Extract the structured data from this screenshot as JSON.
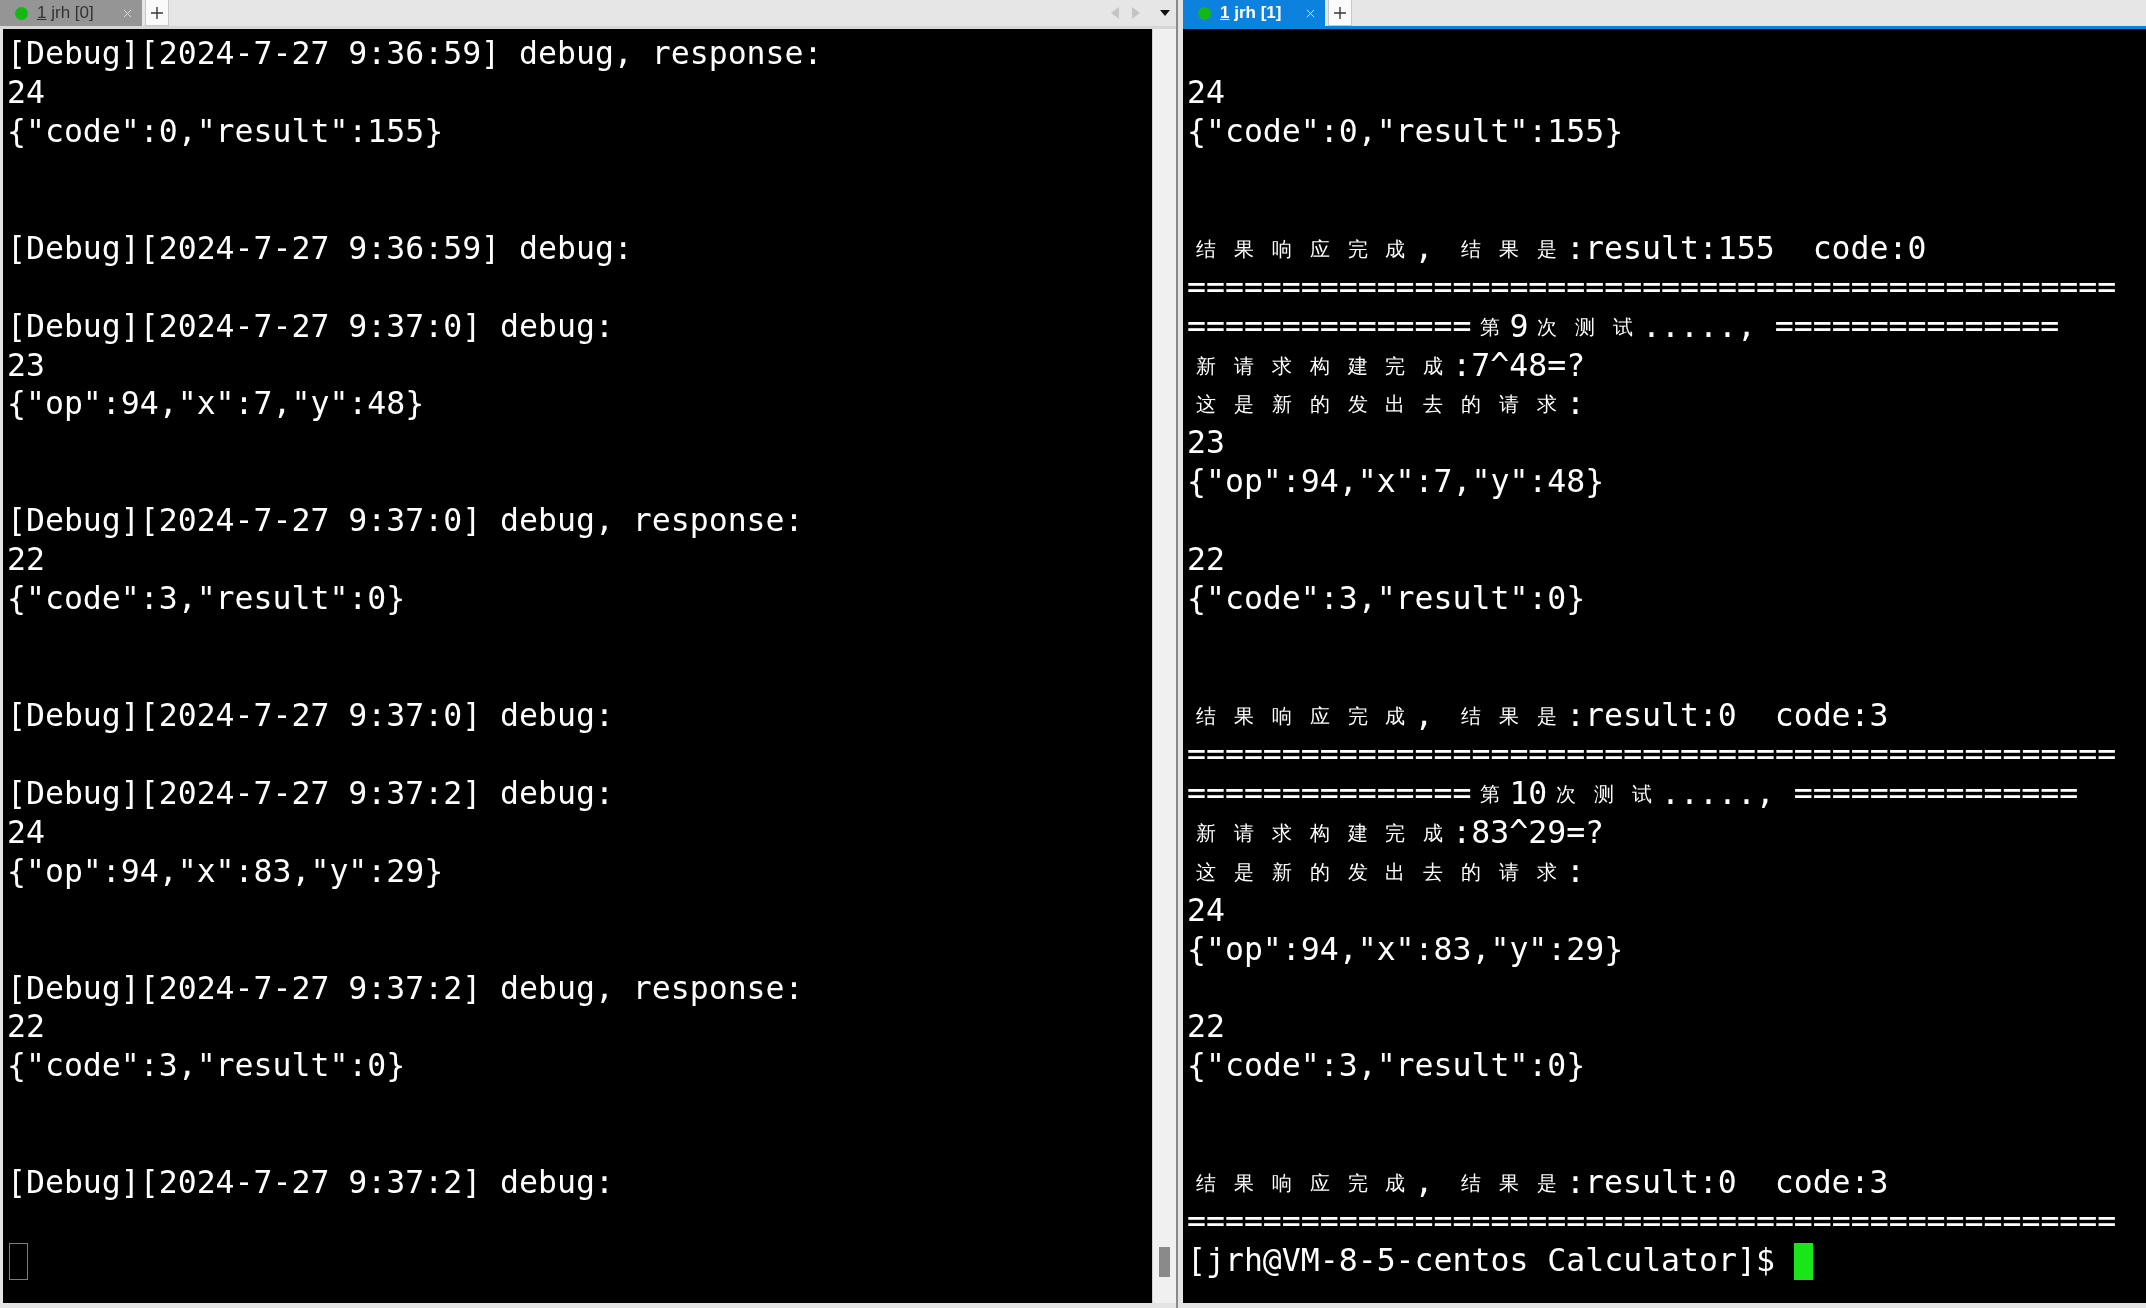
{
  "panes": [
    {
      "tab": {
        "label": "1 jrh [0]",
        "selected": false
      },
      "focused": false,
      "tab_nav": true,
      "scrollbar": true,
      "lines": [
        {
          "kind": "text",
          "text": "[Debug][2024-7-27 9:36:59] debug, response:"
        },
        {
          "kind": "text",
          "text": "24"
        },
        {
          "kind": "text",
          "text": "{\"code\":0,\"result\":155}"
        },
        {
          "kind": "blank"
        },
        {
          "kind": "blank"
        },
        {
          "kind": "text",
          "text": "[Debug][2024-7-27 9:36:59] debug:"
        },
        {
          "kind": "blank"
        },
        {
          "kind": "text",
          "text": "[Debug][2024-7-27 9:37:0] debug:"
        },
        {
          "kind": "text",
          "text": "23"
        },
        {
          "kind": "text",
          "text": "{\"op\":94,\"x\":7,\"y\":48}"
        },
        {
          "kind": "blank"
        },
        {
          "kind": "blank"
        },
        {
          "kind": "text",
          "text": "[Debug][2024-7-27 9:37:0] debug, response:"
        },
        {
          "kind": "text",
          "text": "22"
        },
        {
          "kind": "text",
          "text": "{\"code\":3,\"result\":0}"
        },
        {
          "kind": "blank"
        },
        {
          "kind": "blank"
        },
        {
          "kind": "text",
          "text": "[Debug][2024-7-27 9:37:0] debug:"
        },
        {
          "kind": "blank"
        },
        {
          "kind": "text",
          "text": "[Debug][2024-7-27 9:37:2] debug:"
        },
        {
          "kind": "text",
          "text": "24"
        },
        {
          "kind": "text",
          "text": "{\"op\":94,\"x\":83,\"y\":29}"
        },
        {
          "kind": "blank"
        },
        {
          "kind": "blank"
        },
        {
          "kind": "text",
          "text": "[Debug][2024-7-27 9:37:2] debug, response:"
        },
        {
          "kind": "text",
          "text": "22"
        },
        {
          "kind": "text",
          "text": "{\"code\":3,\"result\":0}"
        },
        {
          "kind": "blank"
        },
        {
          "kind": "blank"
        },
        {
          "kind": "text",
          "text": "[Debug][2024-7-27 9:37:2] debug:"
        },
        {
          "kind": "blank"
        }
      ]
    },
    {
      "tab": {
        "label": "1 jrh [1]",
        "selected": true
      },
      "focused": true,
      "tab_nav": false,
      "scrollbar": false,
      "lines": [
        {
          "kind": "blank"
        },
        {
          "kind": "text",
          "text": "24"
        },
        {
          "kind": "text",
          "text": "{\"code\":0,\"result\":155}"
        },
        {
          "kind": "blank"
        },
        {
          "kind": "blank"
        },
        {
          "kind": "text",
          "text": "结果响应完成, 结果是:result:155  code:0"
        },
        {
          "kind": "text",
          "text": "================================================="
        },
        {
          "kind": "text",
          "text": "===============第9次测试....., ==============="
        },
        {
          "kind": "text",
          "text": "新请求构建完成:7^48=?"
        },
        {
          "kind": "text",
          "text": "这是新的发出去的请求:"
        },
        {
          "kind": "text",
          "text": "23"
        },
        {
          "kind": "text",
          "text": "{\"op\":94,\"x\":7,\"y\":48}"
        },
        {
          "kind": "blank"
        },
        {
          "kind": "text",
          "text": "22"
        },
        {
          "kind": "text",
          "text": "{\"code\":3,\"result\":0}"
        },
        {
          "kind": "blank"
        },
        {
          "kind": "blank"
        },
        {
          "kind": "text",
          "text": "结果响应完成, 结果是:result:0  code:3"
        },
        {
          "kind": "text",
          "text": "================================================="
        },
        {
          "kind": "text",
          "text": "===============第10次测试....., ==============="
        },
        {
          "kind": "text",
          "text": "新请求构建完成:83^29=?"
        },
        {
          "kind": "text",
          "text": "这是新的发出去的请求:"
        },
        {
          "kind": "text",
          "text": "24"
        },
        {
          "kind": "text",
          "text": "{\"op\":94,\"x\":83,\"y\":29}"
        },
        {
          "kind": "blank"
        },
        {
          "kind": "text",
          "text": "22"
        },
        {
          "kind": "text",
          "text": "{\"code\":3,\"result\":0}"
        },
        {
          "kind": "blank"
        },
        {
          "kind": "blank"
        },
        {
          "kind": "text",
          "text": "结果响应完成, 结果是:result:0  code:3"
        },
        {
          "kind": "text",
          "text": "================================================="
        }
      ],
      "input_line": "[jrh@VM-8-5-centos Calculator]$"
    }
  ]
}
